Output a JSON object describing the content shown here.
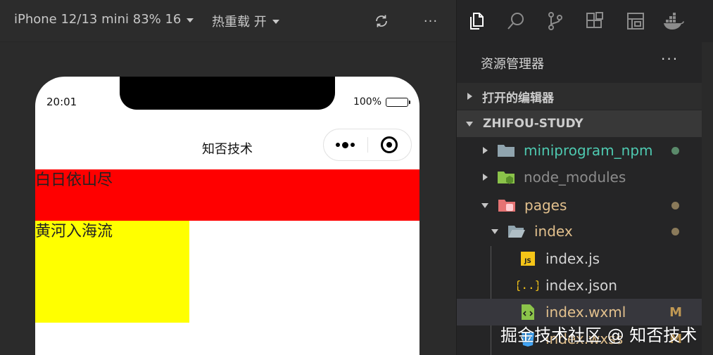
{
  "simulator_toolbar": {
    "device_label": "iPhone 12/13 mini 83% 16",
    "hot_reload_label": "热重载 开",
    "refresh_icon": "refresh-icon",
    "more_label": "···"
  },
  "phone": {
    "status_time": "20:01",
    "battery_percent": "100%",
    "nav_title": "知否技术",
    "box_red_text": "白日依山尽",
    "box_yellow_text": "黄河入海流",
    "box_red_color": "#ff0000",
    "box_yellow_color": "#ffff00"
  },
  "explorer": {
    "activity_icons": [
      "files-icon",
      "search-icon",
      "source-control-icon",
      "extensions-icon",
      "layout-icon",
      "docker-icon"
    ],
    "header": "资源管理器",
    "more_label": "···",
    "open_editors_label": "打开的编辑器",
    "project_label": "ZHIFOU-STUDY",
    "tree": [
      {
        "label": "miniprogram_npm",
        "color": "#4ec9b0",
        "dot": "#5a8a6a"
      },
      {
        "label": "node_modules",
        "color": "#8c8c8c"
      },
      {
        "label": "pages",
        "color": "#e2c08d",
        "dot": "#8a7a5a"
      },
      {
        "label": "index",
        "color": "#e2c08d",
        "dot": "#8a7a5a"
      },
      {
        "label": "index.js",
        "color": "#d4d4d4"
      },
      {
        "label": "index.json",
        "color": "#d4d4d4"
      },
      {
        "label": "index.wxml",
        "color": "#e2c08d",
        "badge": "M"
      },
      {
        "label": "index.wxss",
        "color": "#e2c08d",
        "badge": "M"
      }
    ]
  },
  "watermark": "掘金技术社区 @ 知否技术"
}
